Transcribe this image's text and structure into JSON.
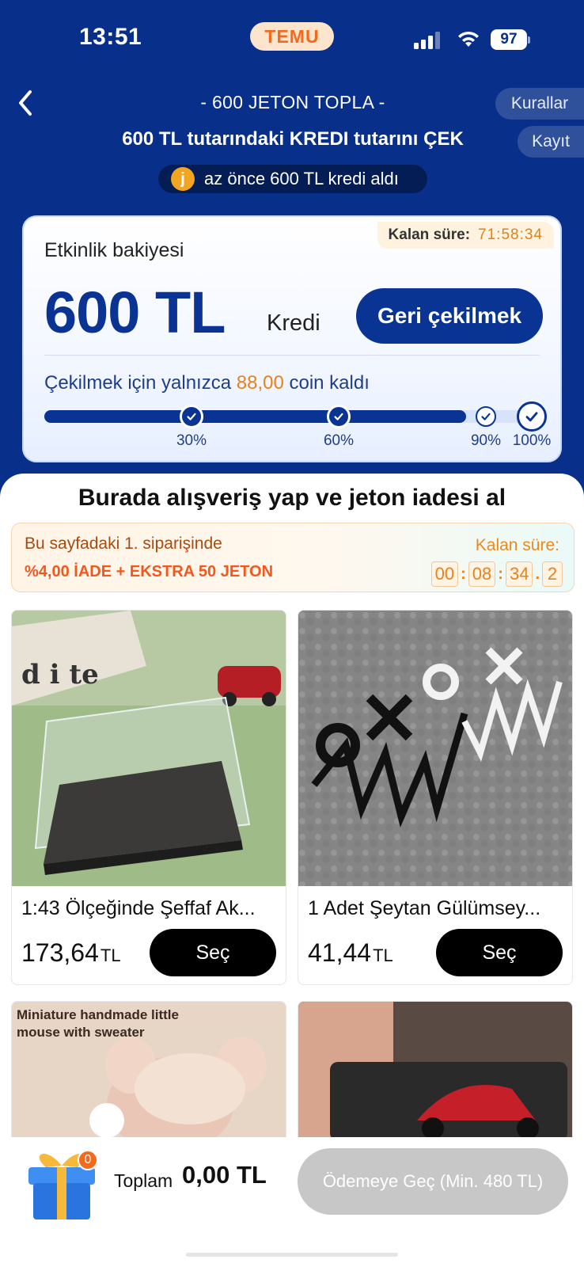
{
  "status_bar": {
    "time": "13:51",
    "app_badge": "TEMU",
    "battery": "97"
  },
  "header": {
    "title": "- 600 JETON TOPLA -",
    "subtitle": "600 TL tutarındaki KREDI tutarını ÇEK",
    "rules_label": "Kurallar",
    "record_label": "Kayıt",
    "ticker_coin": "j",
    "ticker_text": "az önce 600 TL kredi aldı"
  },
  "balance": {
    "time_label": "Kalan süre:",
    "time_value": "71:58:34",
    "label": "Etkinlik bakiyesi",
    "amount": "600 TL",
    "unit": "Kredi",
    "withdraw_label": "Geri çekilmek",
    "remaining_prefix": "Çekilmek için yalnızca",
    "remaining_amount": "88,00",
    "remaining_suffix": "coin kaldı",
    "progress": 0.86,
    "milestones": [
      {
        "label": "30%",
        "value": 0.3,
        "reached": true
      },
      {
        "label": "60%",
        "value": 0.6,
        "reached": true
      },
      {
        "label": "90%",
        "value": 0.9,
        "reached": false
      },
      {
        "label": "100%",
        "value": 1.0,
        "reached": false
      }
    ]
  },
  "section": {
    "title": "Burada alışveriş yap ve jeton iadesi al"
  },
  "promo": {
    "line1": "Bu sayfadaki 1. siparişinde",
    "refund": "%4,00 İADE",
    "plus": "+",
    "extra": "EKSTRA 50 JETON",
    "time_label": "Kalan süre:",
    "clock": {
      "h": "00",
      "m": "08",
      "s": "34",
      "f": "2"
    }
  },
  "products": [
    {
      "title": "1:43 Ölçeğinde Şeffaf Ak...",
      "price": "173,64",
      "currency": "TL",
      "button": "Seç"
    },
    {
      "title": "1 Adet Şeytan Gülümsey...",
      "price": "41,44",
      "currency": "TL",
      "button": "Seç"
    },
    {
      "image_text": "Miniature handmade little mouse with sweater"
    },
    {}
  ],
  "bottom": {
    "gift_count": "0",
    "total_label": "Toplam",
    "total_value": "0,00 TL",
    "checkout_label": "Ödemeye Geç (Min. 480 TL)"
  },
  "colors": {
    "primary": "#0a3494",
    "background": "#08308a",
    "accent": "#e8821c",
    "temu": "#f46a1c"
  }
}
